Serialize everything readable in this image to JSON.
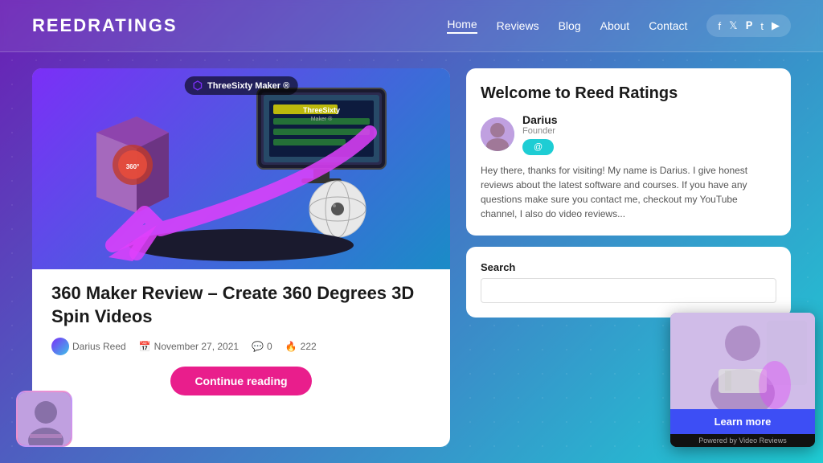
{
  "header": {
    "logo": "ReedRatings",
    "nav": {
      "items": [
        {
          "label": "Home",
          "active": true
        },
        {
          "label": "Reviews",
          "active": false
        },
        {
          "label": "Blog",
          "active": false
        },
        {
          "label": "About",
          "active": false
        },
        {
          "label": "Contact",
          "active": false
        }
      ]
    },
    "social": [
      "f",
      "t",
      "p",
      "t",
      "yt"
    ]
  },
  "article": {
    "title": "360 Maker Review – Create 360 Degrees 3D Spin Videos",
    "author": "Darius Reed",
    "date": "November 27, 2021",
    "comments": "0",
    "views": "222",
    "continue_label": "Continue reading"
  },
  "sidebar": {
    "welcome_title": "Welcome to Reed Ratings",
    "author_name": "Darius",
    "author_role": "Founder",
    "description": "Hey there, thanks for visiting! My name is Darius. I give honest reviews about the latest software and courses. If you have any questions make sure you contact me, checkout my YouTube channel, I also do video reviews...",
    "search_label": "Search",
    "search_placeholder": ""
  },
  "video_popup": {
    "learn_more_label": "Learn more",
    "powered_by": "Powered by Video Reviews"
  }
}
